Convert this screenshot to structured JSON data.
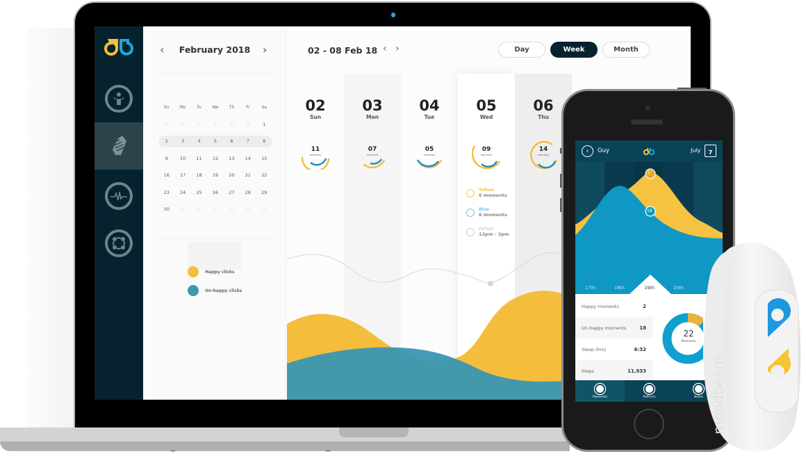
{
  "colors": {
    "sidebar_bg": "#06222e",
    "happy_yellow": "#f5bd3c",
    "unhappy_blue": "#2e8eab",
    "phone_header": "#0a4257",
    "phone_blue": "#0f98c3"
  },
  "desktop": {
    "sidebar": {
      "logo": "db-logo",
      "items": [
        {
          "icon": "family-icon",
          "active": false
        },
        {
          "icon": "handshake-icon",
          "active": true
        },
        {
          "icon": "heartbeat-icon",
          "active": false
        },
        {
          "icon": "community-icon",
          "active": false
        }
      ]
    },
    "calendar": {
      "title": "February 2018",
      "prev_icon": "chevron-left-icon",
      "next_icon": "chevron-right-icon",
      "weekdays": [
        "Su",
        "Mo",
        "Tu",
        "We",
        "Th",
        "Fr",
        "Sa"
      ],
      "weeks": [
        [
          "",
          "",
          "",
          "",
          "",
          "",
          "1"
        ],
        [
          "2",
          "3",
          "4",
          "5",
          "6",
          "7",
          "8"
        ],
        [
          "9",
          "10",
          "11",
          "12",
          "13",
          "14",
          "15"
        ],
        [
          "16",
          "17",
          "18",
          "19",
          "20",
          "21",
          "22"
        ],
        [
          "23",
          "24",
          "25",
          "26",
          "27",
          "28",
          "29"
        ],
        [
          "30",
          "",
          "",
          "",
          "",
          "",
          ""
        ]
      ],
      "highlighted_week": 1,
      "legend": [
        {
          "label": "Happy clicks",
          "color": "#f5bd3c"
        },
        {
          "label": "Un-happy clicks",
          "color": "#3d98b0"
        }
      ]
    },
    "main": {
      "range": "02 - 08 Feb 18",
      "view_buttons": [
        {
          "label": "Day",
          "active": false
        },
        {
          "label": "Week",
          "active": true
        },
        {
          "label": "Month",
          "active": false
        }
      ],
      "days": [
        {
          "num": "02",
          "name": "Sun",
          "moments": "11",
          "sub": "moments"
        },
        {
          "num": "03",
          "name": "Mon",
          "moments": "07",
          "sub": "moments"
        },
        {
          "num": "04",
          "name": "Tue",
          "moments": "05",
          "sub": "moments"
        },
        {
          "num": "05",
          "name": "Wed",
          "moments": "09",
          "sub": "moments"
        },
        {
          "num": "06",
          "name": "Thu",
          "moments": "14",
          "sub": "moments"
        }
      ],
      "details": [
        {
          "icon": "happy-face-icon",
          "title": "Yellow",
          "value": "6 moments",
          "color": "#f5c25a"
        },
        {
          "icon": "sad-face-icon",
          "title": "Blue",
          "value": "6 moments",
          "color": "#7cc3df"
        },
        {
          "icon": "clock-icon",
          "title": "Pattern",
          "value": "12pm - 2pm",
          "color": "#bbbbbb"
        }
      ]
    }
  },
  "phone": {
    "header": {
      "back_label": "Guy",
      "month": "July",
      "calendar_day": "7"
    },
    "chart": {
      "x_labels": [
        "17th",
        "18th",
        "19th",
        "20th"
      ],
      "selected": "19th",
      "happy_marker": "2",
      "unhappy_marker": "18"
    },
    "stats": [
      {
        "label": "Happy moments",
        "value": "2"
      },
      {
        "label": "Un-happy moments",
        "value": "18"
      },
      {
        "label": "Sleep (hrs)",
        "value": "6:32"
      },
      {
        "label": "Steps",
        "value": "11,933"
      }
    ],
    "donut": {
      "total": "22",
      "label": "Moments",
      "happy": 2,
      "unhappy": 20
    },
    "nav": [
      {
        "label": "Moments",
        "icon": "moments-icon"
      },
      {
        "label": "Patterns",
        "icon": "patterns-icon"
      },
      {
        "label": "Notes",
        "icon": "notes-icon"
      }
    ]
  },
  "band": {
    "brand": "moodbeam"
  }
}
